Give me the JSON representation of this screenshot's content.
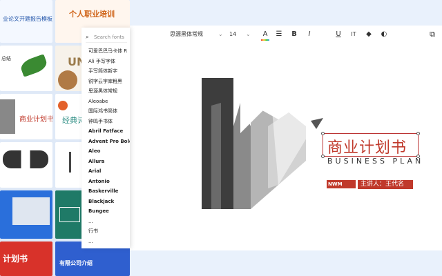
{
  "thumbnails": [
    {
      "label": "业论文开题报告模板",
      "bg": "#f4f8ff",
      "fg": "#2255aa"
    },
    {
      "label": "个人职业培训",
      "bg": "#fff6ee",
      "fg": "#d0651a"
    },
    {
      "label": "总结",
      "bg": "#ffffff",
      "fg": "#333333"
    },
    {
      "label": "UNI",
      "bg": "#f7f2ea",
      "fg": "#9a7a4a"
    },
    {
      "label": "商业计划书",
      "bg": "#ffffff",
      "fg": "#c0392b"
    },
    {
      "label": "经典诗",
      "bg": "#ffffff",
      "fg": "#2a8c82"
    },
    {
      "label": "",
      "bg": "#ffffff",
      "fg": "#555555"
    },
    {
      "label": "",
      "bg": "#ffffff",
      "fg": "#555555"
    },
    {
      "label": "",
      "bg": "#2a6fdb",
      "fg": "#ffffff"
    },
    {
      "label": "",
      "bg": "#1f7a67",
      "fg": "#ffffff"
    },
    {
      "label": "计划书",
      "bg": "#d8322a",
      "fg": "#ffffff"
    },
    {
      "label": "有限公司介绍",
      "bg": "#2f5fcf",
      "fg": "#ffffff"
    }
  ],
  "font_panel": {
    "search_placeholder": "Search fonts",
    "fonts": [
      "可爱巴巴马卡体 R",
      "Ali 手写字体",
      "手写简体新字",
      "锐字云字库粗黑",
      "思源黑体常规",
      "Aleoabe",
      "国际鸿书简体",
      "钟鸣手书体",
      "Abril Fatface",
      "Advent Pro Bold",
      "Aleo",
      "Allura",
      "Arial",
      "Antonio",
      "Baskerville",
      "Blackjack",
      "Bungee",
      "...",
      "行书",
      "..."
    ]
  },
  "toolbar": {
    "font_name": "思源黑体常规",
    "font_size": "14",
    "items": [
      "A",
      "☰",
      "B",
      "I",
      "U",
      "IT",
      "◆",
      "◐"
    ]
  },
  "slide": {
    "title_cn": "商业计划书",
    "title_en": "BUSINESS PLAN",
    "badge": "NWM",
    "speaker_label": "主讲人：王代名"
  },
  "colors": {
    "accent_red": "#c0392b",
    "panel_bg": "#ffffff"
  }
}
